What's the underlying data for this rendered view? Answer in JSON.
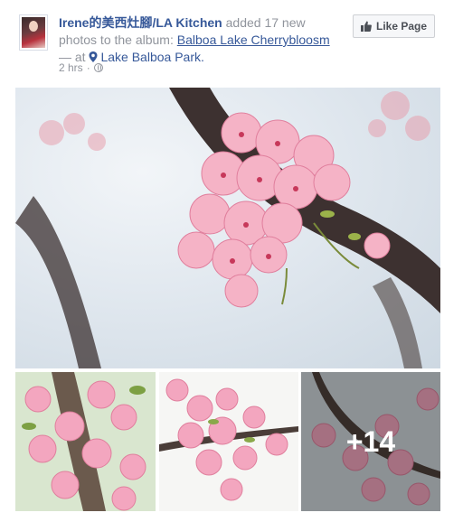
{
  "post": {
    "page_name": "Irene的美西灶腳/LA Kitchen",
    "action_text": "added 17 new photos to the album:",
    "album_name": "Balboa Lake Cherrybloosm",
    "at_text": "— at",
    "location": "Lake Balboa Park.",
    "time": "2 hrs",
    "separator": "·",
    "privacy_icon": "globe-icon"
  },
  "like_button": {
    "label": "Like Page",
    "icon": "thumbs-up-icon"
  },
  "photos": {
    "main_alt": "cherry-blossom-main-photo",
    "more_count": "+14"
  },
  "colors": {
    "link": "#365899",
    "meta": "#90949c",
    "blossom": "#f3a6bf"
  }
}
